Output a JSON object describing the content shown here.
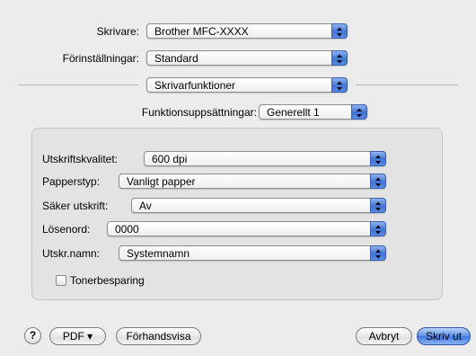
{
  "printer": {
    "label": "Skrivare:",
    "value": "Brother MFC-XXXX"
  },
  "presets": {
    "label": "Förinställningar:",
    "value": "Standard"
  },
  "panel": {
    "value": "Skrivarfunktioner"
  },
  "feature_sets": {
    "label": "Funktionsuppsättningar:",
    "value": "Generellt 1"
  },
  "settings": {
    "quality": {
      "label": "Utskriftskvalitet:",
      "value": "600 dpi"
    },
    "media": {
      "label": "Papperstyp:",
      "value": "Vanligt papper"
    },
    "secure": {
      "label": "Säker utskrift:",
      "value": "Av"
    },
    "password": {
      "label": "Lösenord:",
      "value": "0000"
    },
    "job_name": {
      "label": "Utskr.namn:",
      "value": "Systemnamn"
    },
    "toner_save": {
      "label": "Tonerbesparing",
      "checked": false
    }
  },
  "footer": {
    "help": "?",
    "pdf": "PDF ▾",
    "preview": "Förhandsvisa",
    "cancel": "Avbryt",
    "print": "Skriv ut"
  },
  "colors": {
    "accent": "#3f74d6",
    "background": "#ececec"
  }
}
